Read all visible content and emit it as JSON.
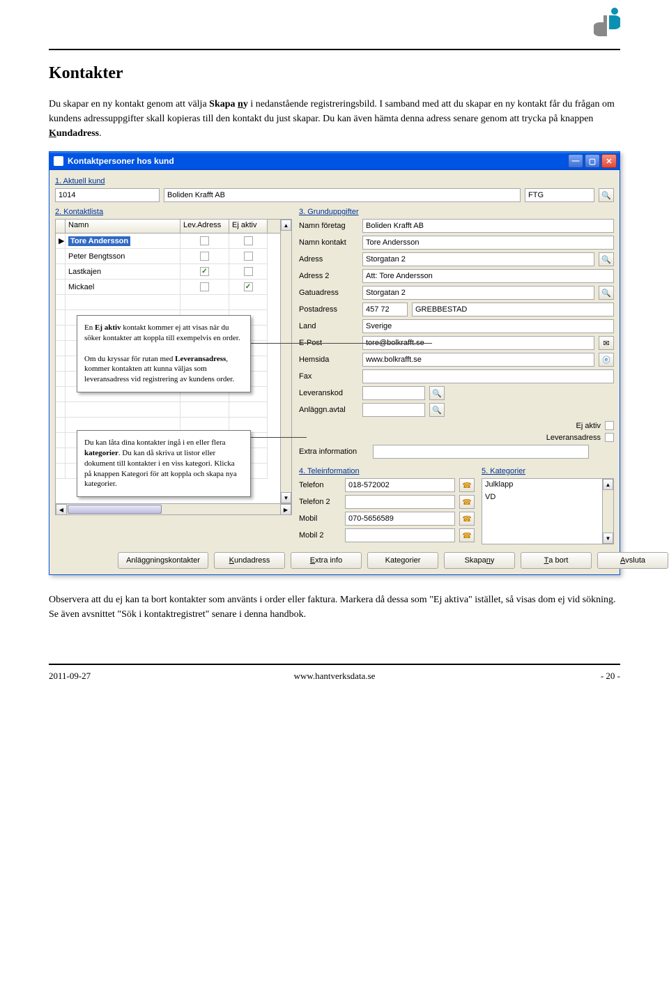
{
  "document": {
    "heading": "Kontakter",
    "para1_a": "Du skapar en ny kontakt genom att välja ",
    "para1_bold_pre": "Skapa ",
    "para1_bold_ul": "n",
    "para1_bold_post": "y",
    "para1_b": " i nedanstående registreringsbild. I samband med att du skapar en ny kontakt får du frågan om kundens adressuppgifter skall kopieras till den kontakt du just skapar. Du kan även hämta denna adress senare genom att trycka på knappen ",
    "para1_bold2_ul": "K",
    "para1_bold2_rest": "undadress",
    "para1_end": ".",
    "para2": "Observera att du ej kan ta bort kontakter som använts i order eller faktura. Markera då dessa som \"Ej aktiva\" istället, så visas dom ej vid sökning. Se även avsnittet \"Sök i kontaktregistret\" senare i denna handbok."
  },
  "window": {
    "title": "Kontaktpersoner hos kund",
    "section1": "1. Aktuell kund",
    "kund_id": "1014",
    "kund_namn": "Boliden Krafft AB",
    "kund_typ": "FTG",
    "section2": "2. Kontaktlista",
    "table_headers": {
      "namn": "Namn",
      "lev": "Lev.Adress",
      "ej": "Ej aktiv"
    },
    "contacts": [
      {
        "name": "Tore Andersson",
        "lev": false,
        "ej": false,
        "selected": true
      },
      {
        "name": "Peter Bengtsson",
        "lev": false,
        "ej": false,
        "selected": false
      },
      {
        "name": "Lastkajen",
        "lev": true,
        "ej": false,
        "selected": false
      },
      {
        "name": "Mickael",
        "lev": false,
        "ej": true,
        "selected": false
      }
    ],
    "section3": "3. Grunduppgifter",
    "fields": {
      "namn_foretag": {
        "label": "Namn företag",
        "value": "Boliden Krafft AB"
      },
      "namn_kontakt": {
        "label": "Namn kontakt",
        "value": "Tore Andersson"
      },
      "adress": {
        "label": "Adress",
        "value": "Storgatan 2"
      },
      "adress2": {
        "label": "Adress 2",
        "value": "Att: Tore Andersson"
      },
      "gatuadress": {
        "label": "Gatuadress",
        "value": "Storgatan 2"
      },
      "postadress": {
        "label": "Postadress",
        "value_nr": "457 72",
        "value_ort": "GREBBESTAD"
      },
      "land": {
        "label": "Land",
        "value": "Sverige"
      },
      "epost": {
        "label": "E-Post",
        "value": "tore@bolkrafft.se"
      },
      "hemsida": {
        "label": "Hemsida",
        "value": "www.bolkrafft.se"
      },
      "fax": {
        "label": "Fax",
        "value": ""
      },
      "leveranskod": {
        "label": "Leveranskod",
        "value": ""
      },
      "anlaggn": {
        "label": "Anläggn.avtal",
        "value": ""
      },
      "ejaktiv": {
        "label": "Ej aktiv"
      },
      "levadress": {
        "label": "Leveransadress"
      },
      "extrainfo": {
        "label": "Extra information",
        "value": ""
      }
    },
    "section4": "4. Teleinformation",
    "tele": {
      "telefon": {
        "label": "Telefon",
        "value": "018-572002"
      },
      "telefon2": {
        "label": "Telefon 2",
        "value": ""
      },
      "mobil": {
        "label": "Mobil",
        "value": "070-5656589"
      },
      "mobil2": {
        "label": "Mobil 2",
        "value": ""
      }
    },
    "section5": "5. Kategorier",
    "kategorier": [
      "Julklapp",
      "VD"
    ],
    "buttons": {
      "anlaggn": "Anläggningskontakter",
      "kundadress": "Kundadress",
      "extra": "Extra info",
      "kategorier": "Kategorier",
      "skapany": "Skapa ny",
      "tabort": "Ta bort",
      "avsluta": "Avsluta"
    }
  },
  "callouts": {
    "c1_a": "En ",
    "c1_bold1": "Ej aktiv",
    "c1_b": " kontakt kommer ej att visas när du söker kontakter att koppla till exempelvis en order.",
    "c1_c": "Om du kryssar för rutan med ",
    "c1_bold2": "Leveransadress",
    "c1_d": ", kommer kontakten att kunna väljas som leveransadress vid registrering av kundens order.",
    "c2_a": "Du kan låta dina kontakter ingå i en eller flera ",
    "c2_bold1": "kategorier",
    "c2_b": ". Du kan då skriva ut listor eller dokument till kontakter i en viss kategori. Klicka på knappen Kategori för att koppla och skapa nya kategorier."
  },
  "footer": {
    "date": "2011-09-27",
    "url": "www.hantverksdata.se",
    "page": "- 20 -"
  }
}
